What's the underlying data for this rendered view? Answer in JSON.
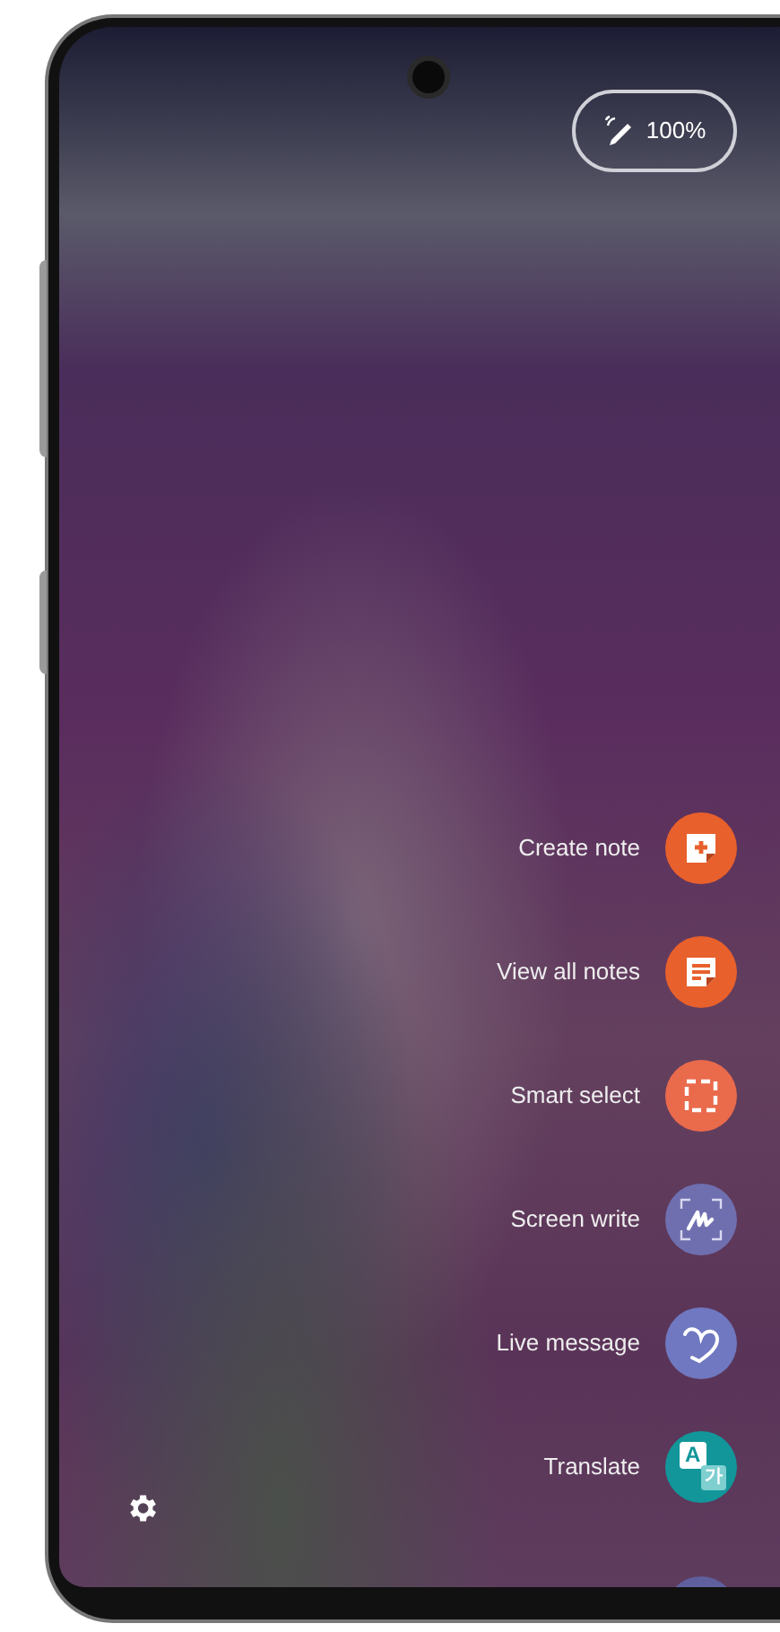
{
  "pen_status": {
    "battery": "100%"
  },
  "air_command": [
    {
      "kind": "create_note",
      "label": "Create note"
    },
    {
      "kind": "view_notes",
      "label": "View all notes"
    },
    {
      "kind": "smart_select",
      "label": "Smart select"
    },
    {
      "kind": "screen_write",
      "label": "Screen write"
    },
    {
      "kind": "live_message",
      "label": "Live message"
    },
    {
      "kind": "translate",
      "label": "Translate",
      "glyphs": [
        "A",
        "가"
      ]
    },
    {
      "kind": "partial"
    }
  ]
}
